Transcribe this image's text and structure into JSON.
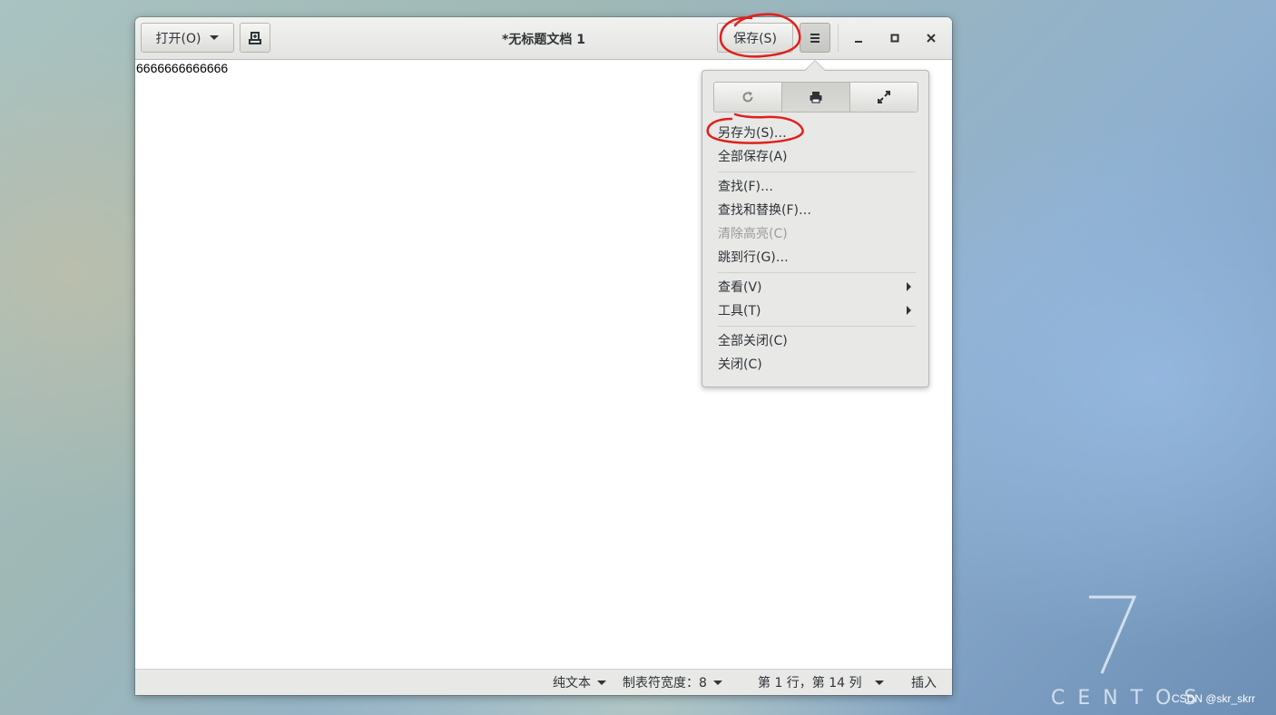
{
  "window": {
    "title": "*无标题文档 1",
    "open_label": "打开(O)",
    "save_label": "保存(S)"
  },
  "editor": {
    "content": "6666666666666"
  },
  "menu": {
    "top_buttons": [
      "reload-icon",
      "print-icon",
      "fullscreen-icon"
    ],
    "items": [
      {
        "label": "另存为(S)…"
      },
      {
        "label": "全部保存(A)"
      },
      {
        "label": "查找(F)…"
      },
      {
        "label": "查找和替换(F)…"
      },
      {
        "label": "清除高亮(C)",
        "disabled": true
      },
      {
        "label": "跳到行(G)…"
      },
      {
        "label": "查看(V)",
        "submenu": true
      },
      {
        "label": "工具(T)",
        "submenu": true
      },
      {
        "label": "全部关闭(C)"
      },
      {
        "label": "关闭(C)"
      }
    ]
  },
  "statusbar": {
    "language": "纯文本",
    "tab_width": "制表符宽度：8",
    "position": "第 1 行，第 14 列",
    "mode": "插入"
  },
  "desktop": {
    "logo_number": "7",
    "logo_text": "CENTOS",
    "watermark": "CSDN @skr_skrr"
  },
  "colors": {
    "annotation": "#e0201b",
    "menu_background": "#e8e8e7",
    "headerbar": "#e4e4e2"
  }
}
